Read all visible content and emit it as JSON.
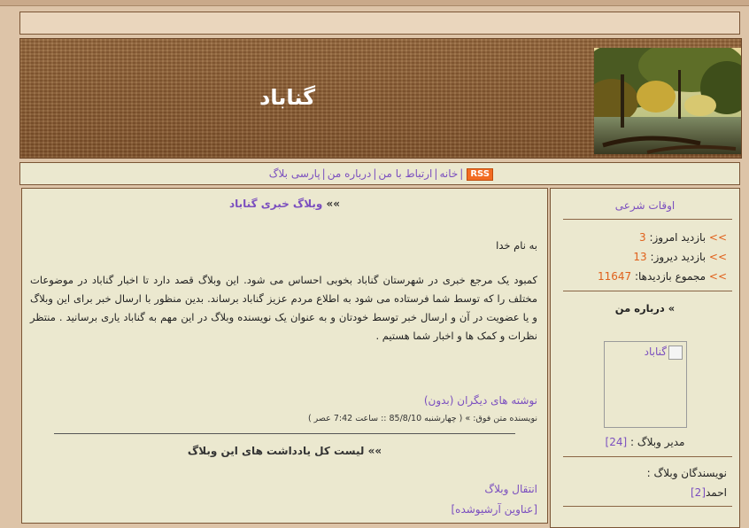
{
  "header": {
    "title": "گناباد"
  },
  "nav": {
    "rss_label": "RSS",
    "items": [
      "خانه",
      "ارتباط با من",
      "درباره من",
      "پارسی بلاگ"
    ],
    "separator": "|"
  },
  "post": {
    "title_arrows": "»»",
    "title": "وبلاگ خبری گناباد",
    "greeting": "به نام خدا",
    "body": "کمبود یک مرجع خبری در شهرستان گناباد بخوبی احساس می شود. این وبلاگ قصد دارد تا اخبار گناباد در موضوعات مختلف را که توسط شما فرستاده می شود به اطلاع مردم عزیز گناباد برساند. بدین منظور با ارسال خبر برای این وبلاگ و یا عضویت در آن و ارسال خبر توسط خودتان و به عنوان یک نویسنده وبلاگ در این مهم به گناباد یاری برسانید . منتظر نظرات و کمک ها و اخبار شما هستیم .",
    "others_link": "نوشته های دیگران (بدون)",
    "meta": "نویسنده متن فوق: » ( چهارشنبه 85/8/10 :: ساعت 7:42 عصر )",
    "list_all_arrows": "»»",
    "list_all": "لیست کل یادداشت های این وبلاگ",
    "transfer_link": "انتقال وبلاگ",
    "archive_link": "[عناوین آرشیوشده]"
  },
  "sidebar": {
    "prayer_times": "اوقات شرعی",
    "stat_arrows": ">>",
    "today_label": "بازدید امروز:",
    "today_value": "3",
    "yesterday_label": "بازدید دیروز:",
    "yesterday_value": "13",
    "total_label": "مجموع بازدیدها:",
    "total_value": "11647",
    "about_label": "» درباره من",
    "image_alt": "گناباد",
    "manager_label": "مدیر وبلاگ :",
    "manager_link": "[24]",
    "writers_label": "نویسندگان وبلاگ :",
    "writer_name": "احمد",
    "writer_link": "[2]"
  }
}
